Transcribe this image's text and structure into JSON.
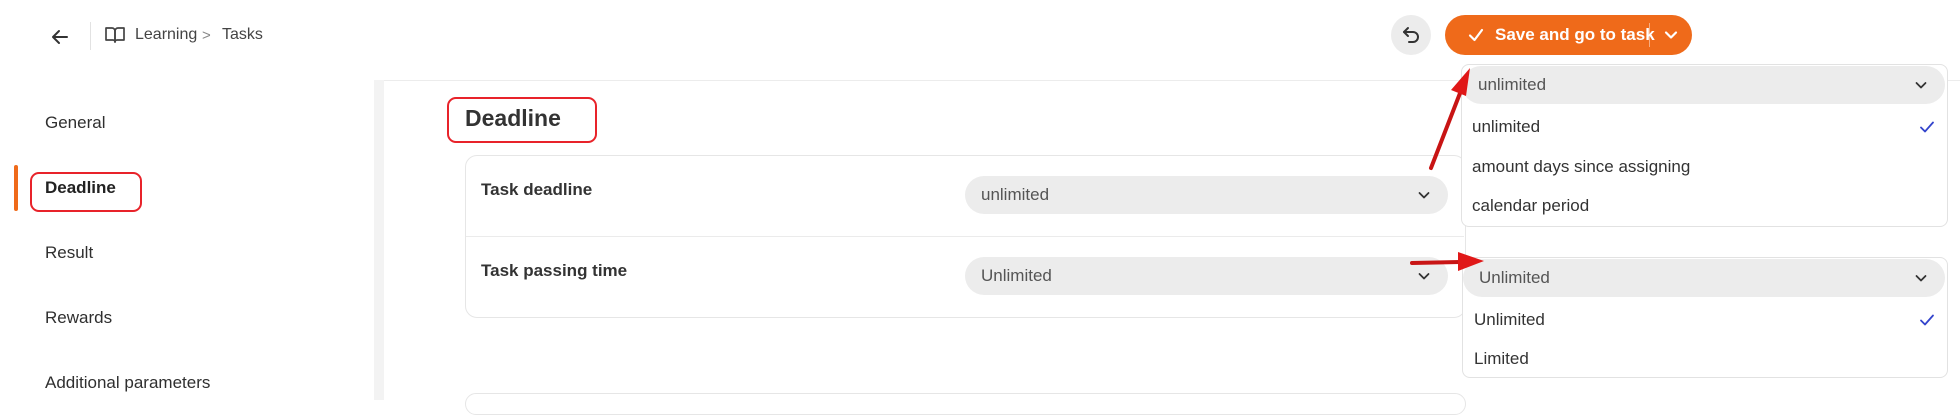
{
  "header": {
    "breadcrumb": [
      "Learning",
      "Tasks"
    ],
    "breadcrumb_separator": ">",
    "save_label": "Save and go to task",
    "icons": [
      "arrow-left-icon",
      "book-icon",
      "undo-icon",
      "check-icon",
      "chevron-down-icon"
    ]
  },
  "sidebar": {
    "items": [
      {
        "label": "General"
      },
      {
        "label": "Deadline",
        "active": true
      },
      {
        "label": "Result"
      },
      {
        "label": "Rewards"
      },
      {
        "label": "Additional parameters"
      }
    ]
  },
  "main": {
    "section_title": "Deadline",
    "fields": [
      {
        "label": "Task deadline",
        "value": "unlimited"
      },
      {
        "label": "Task passing time",
        "value": "Unlimited"
      }
    ]
  },
  "dropdowns": {
    "deadline": {
      "selected": "unlimited",
      "options": [
        "unlimited",
        "amount days since assigning",
        "calendar period"
      ],
      "checked": "unlimited"
    },
    "passing_time": {
      "selected": "Unlimited",
      "options": [
        "Unlimited",
        "Limited"
      ],
      "checked": "Unlimited"
    }
  },
  "colors": {
    "accent": "#ef6a1a",
    "annotation_red": "#e8232a",
    "check_blue": "#3344cc"
  }
}
